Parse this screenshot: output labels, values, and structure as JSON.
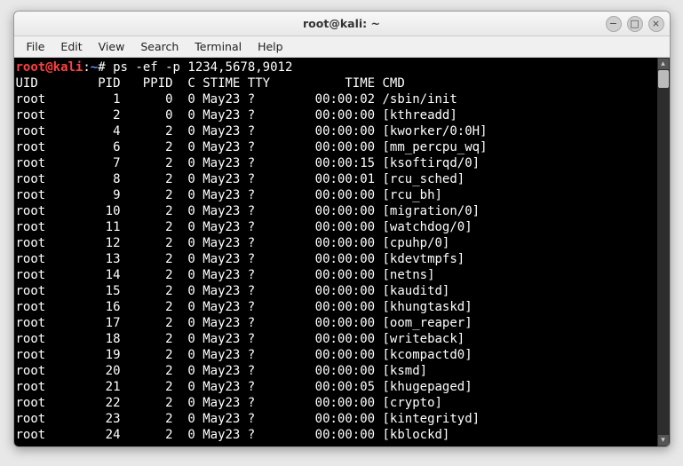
{
  "titlebar": {
    "title": "root@kali: ~",
    "min": "−",
    "max": "□",
    "close": "×"
  },
  "menubar": [
    "File",
    "Edit",
    "View",
    "Search",
    "Terminal",
    "Help"
  ],
  "prompt": {
    "user_host": "root@kali",
    "colon": ":",
    "path": "~",
    "symbol": "#",
    "command": " ps -ef -p 1234,5678,9012"
  },
  "header": "UID        PID   PPID  C STIME TTY          TIME CMD",
  "rows": [
    "root         1      0  0 May23 ?        00:00:02 /sbin/init",
    "root         2      0  0 May23 ?        00:00:00 [kthreadd]",
    "root         4      2  0 May23 ?        00:00:00 [kworker/0:0H]",
    "root         6      2  0 May23 ?        00:00:00 [mm_percpu_wq]",
    "root         7      2  0 May23 ?        00:00:15 [ksoftirqd/0]",
    "root         8      2  0 May23 ?        00:00:01 [rcu_sched]",
    "root         9      2  0 May23 ?        00:00:00 [rcu_bh]",
    "root        10      2  0 May23 ?        00:00:00 [migration/0]",
    "root        11      2  0 May23 ?        00:00:00 [watchdog/0]",
    "root        12      2  0 May23 ?        00:00:00 [cpuhp/0]",
    "root        13      2  0 May23 ?        00:00:00 [kdevtmpfs]",
    "root        14      2  0 May23 ?        00:00:00 [netns]",
    "root        15      2  0 May23 ?        00:00:00 [kauditd]",
    "root        16      2  0 May23 ?        00:00:00 [khungtaskd]",
    "root        17      2  0 May23 ?        00:00:00 [oom_reaper]",
    "root        18      2  0 May23 ?        00:00:00 [writeback]",
    "root        19      2  0 May23 ?        00:00:00 [kcompactd0]",
    "root        20      2  0 May23 ?        00:00:00 [ksmd]",
    "root        21      2  0 May23 ?        00:00:05 [khugepaged]",
    "root        22      2  0 May23 ?        00:00:00 [crypto]",
    "root        23      2  0 May23 ?        00:00:00 [kintegrityd]",
    "root        24      2  0 May23 ?        00:00:00 [kblockd]"
  ]
}
